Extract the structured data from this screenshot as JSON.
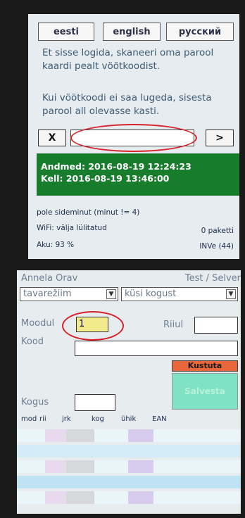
{
  "login": {
    "languages": [
      "eesti",
      "english",
      "русский"
    ],
    "message1": "Et sisse logida, skaneeri oma parool kaardi pealt vöötkoodist.",
    "message2": "Kui vöötkoodi ei saa lugeda, sisesta parool all olevasse kasti.",
    "clear_label": "X",
    "submit_label": ">",
    "password_value": "",
    "data_line": "Andmed: 2016-08-19 12:24:23",
    "clock_line": "Kell: 2016-08-19 13:46:00",
    "connection_status": "pole sideminut (minut != 4)",
    "wifi_status": "WiFi: välja lülitatud",
    "packets": "0 paketti",
    "battery": "Aku: 93 %",
    "version": "INVe (44)"
  },
  "entry": {
    "user": "Annela Orav",
    "context": "Test / Selver",
    "mode_select": "tavarežiim",
    "quantity_select": "küsi kogust",
    "module_label": "Moodul",
    "module_value": "1",
    "shelf_label": "Riiul",
    "code_label": "Kood",
    "delete_label": "Kustuta",
    "save_label": "Salvesta",
    "quantity_label": "Kogus",
    "columns": [
      "mod",
      "rii",
      "jrk",
      "kog",
      "ühik",
      "EAN"
    ]
  },
  "colors": {
    "status_green": "#177c2c",
    "delete_orange": "#e8673a",
    "save_mint": "#7fe3c3",
    "highlight_yellow": "#f2ea8c",
    "annotation_red": "#d7232b"
  }
}
